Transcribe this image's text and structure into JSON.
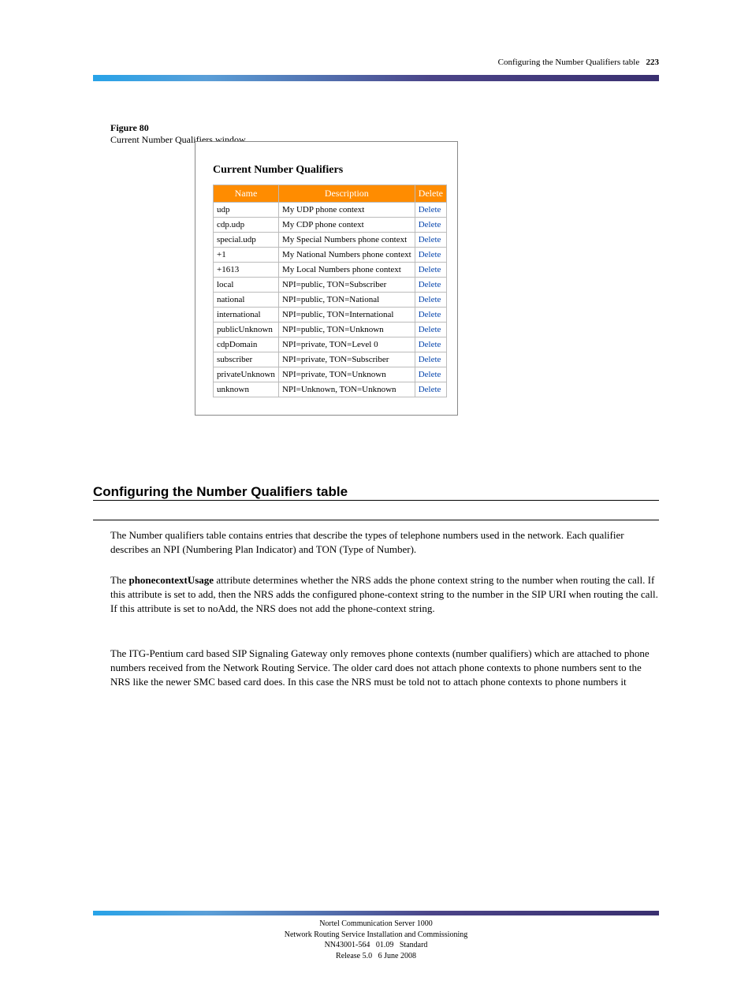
{
  "page_header": {
    "running_title": "Configuring the Number Qualifiers table",
    "page_number": "223"
  },
  "figure": {
    "label": "Figure 80",
    "caption": "Current Number Qualifiers window",
    "title": "Current Number Qualifiers",
    "headers": {
      "name": "Name",
      "description": "Description",
      "delete": "Delete"
    },
    "rows": [
      {
        "name": "udp",
        "description": "My UDP phone context",
        "action": "Delete"
      },
      {
        "name": "cdp.udp",
        "description": "My CDP phone context",
        "action": "Delete"
      },
      {
        "name": "special.udp",
        "description": "My Special Numbers phone context",
        "action": "Delete"
      },
      {
        "name": "+1",
        "description": "My National Numbers phone context",
        "action": "Delete"
      },
      {
        "name": "+1613",
        "description": "My Local Numbers phone context",
        "action": "Delete"
      },
      {
        "name": "local",
        "description": "NPI=public, TON=Subscriber",
        "action": "Delete"
      },
      {
        "name": "national",
        "description": "NPI=public, TON=National",
        "action": "Delete"
      },
      {
        "name": "international",
        "description": "NPI=public, TON=International",
        "action": "Delete"
      },
      {
        "name": "publicUnknown",
        "description": "NPI=public, TON=Unknown",
        "action": "Delete"
      },
      {
        "name": "cdpDomain",
        "description": "NPI=private, TON=Level 0",
        "action": "Delete"
      },
      {
        "name": "subscriber",
        "description": "NPI=private, TON=Subscriber",
        "action": "Delete"
      },
      {
        "name": "privateUnknown",
        "description": "NPI=private, TON=Unknown",
        "action": "Delete"
      },
      {
        "name": "unknown",
        "description": "NPI=Unknown, TON=Unknown",
        "action": "Delete"
      }
    ]
  },
  "section": {
    "heading": "Configuring the Number Qualifiers table"
  },
  "body": {
    "p1": "The Number qualifiers table contains entries that describe the types of telephone numbers used in the network. Each qualifier describes an NPI (Numbering Plan Indicator) and TON (Type of Number).",
    "p2_pre": "The ",
    "p2_bold": "phonecontextUsage",
    "p2_post": " attribute determines whether the NRS adds the phone context string to the number when routing the call. If this attribute is set to add, then the NRS adds the configured phone-context string to the number in the SIP URI when routing the call. If this attribute is set to noAdd, the NRS does not add the phone-context string.",
    "p3": "The ITG-Pentium card based SIP Signaling Gateway only removes phone contexts (number qualifiers) which are attached to phone numbers received from the Network Routing Service. The older card does not attach phone contexts to phone numbers sent to the NRS like the newer SMC based card does. In this case the NRS must be told not to attach phone contexts to phone numbers it"
  },
  "footer": {
    "line1": "Nortel Communication Server 1000",
    "line2": "Network Routing Service Installation and Commissioning",
    "line3_a": "NN43001-564",
    "line3_b": "01.09",
    "line3_c": "Standard",
    "line4_a": "Release 5.0",
    "line4_b": "6 June 2008"
  }
}
